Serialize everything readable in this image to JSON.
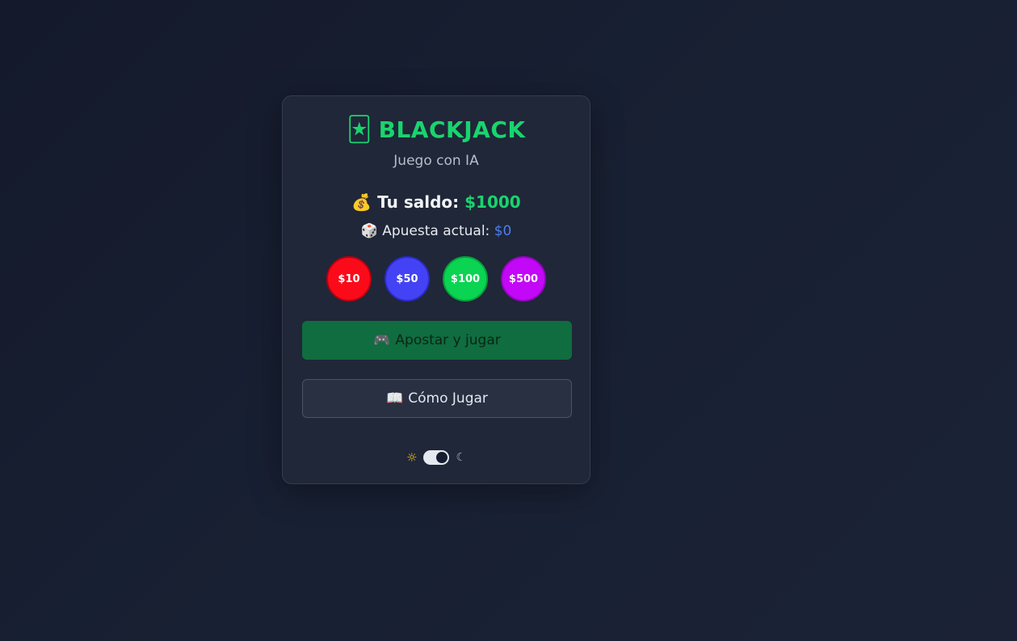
{
  "header": {
    "icon": "joker-card-icon",
    "icon_glyph": "🃏",
    "title": "BLACKJACK",
    "subtitle": "Juego con IA"
  },
  "balance": {
    "icon_glyph": "💰",
    "label": "Tu saldo:",
    "value": "$1000"
  },
  "bet": {
    "icon_glyph": "🎲",
    "label": "Apuesta actual:",
    "value": "$0"
  },
  "chips": [
    {
      "label": "$10",
      "color": "#fb0a1a"
    },
    {
      "label": "$50",
      "color": "#4343f5"
    },
    {
      "label": "$100",
      "color": "#0ad452"
    },
    {
      "label": "$500",
      "color": "#c307f7"
    }
  ],
  "buttons": {
    "play_icon": "🎮",
    "play_label": "Apostar y jugar",
    "help_icon": "📖",
    "help_label": "Cómo Jugar"
  },
  "theme": {
    "sun_glyph": "☼",
    "moon_glyph": "☾",
    "mode": "dark"
  },
  "colors": {
    "accent": "#19d46e",
    "bet_value": "#4f7df2",
    "play_button": "#0f6d3f"
  }
}
